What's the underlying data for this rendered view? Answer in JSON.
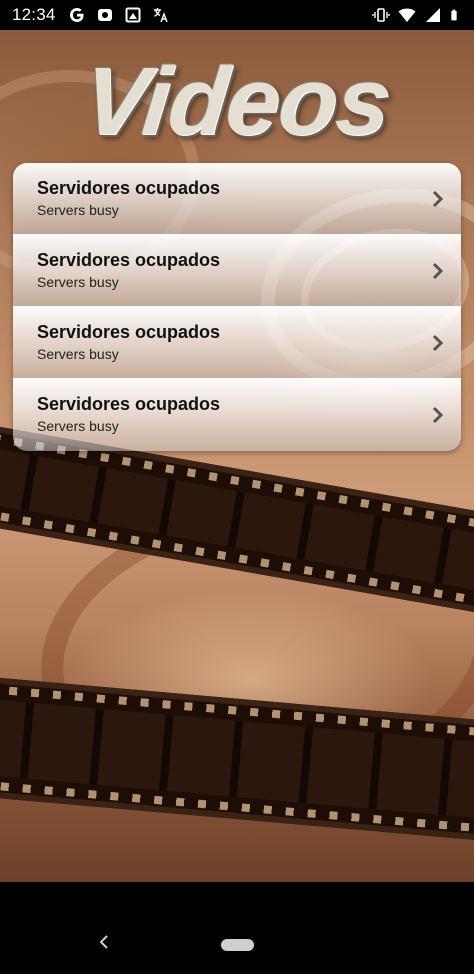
{
  "status_bar": {
    "time": "12:34",
    "left_icons": [
      "google-icon",
      "media-icon",
      "screenshot-icon",
      "translate-icon"
    ],
    "right_icons": [
      "vibrate-icon",
      "wifi-icon",
      "signal-icon",
      "battery-icon"
    ]
  },
  "header": {
    "title": "Videos"
  },
  "server_list": {
    "items": [
      {
        "title": "Servidores ocupados",
        "subtitle": "Servers busy"
      },
      {
        "title": "Servidores ocupados",
        "subtitle": "Servers busy"
      },
      {
        "title": "Servidores ocupados",
        "subtitle": "Servers busy"
      },
      {
        "title": "Servidores ocupados",
        "subtitle": "Servers busy"
      }
    ]
  },
  "nav_bar": {
    "icons": [
      "back-icon",
      "home-pill"
    ]
  },
  "colors": {
    "status_bar_bg": "#000000",
    "list_text": "#111111",
    "chevron": "#555555"
  }
}
